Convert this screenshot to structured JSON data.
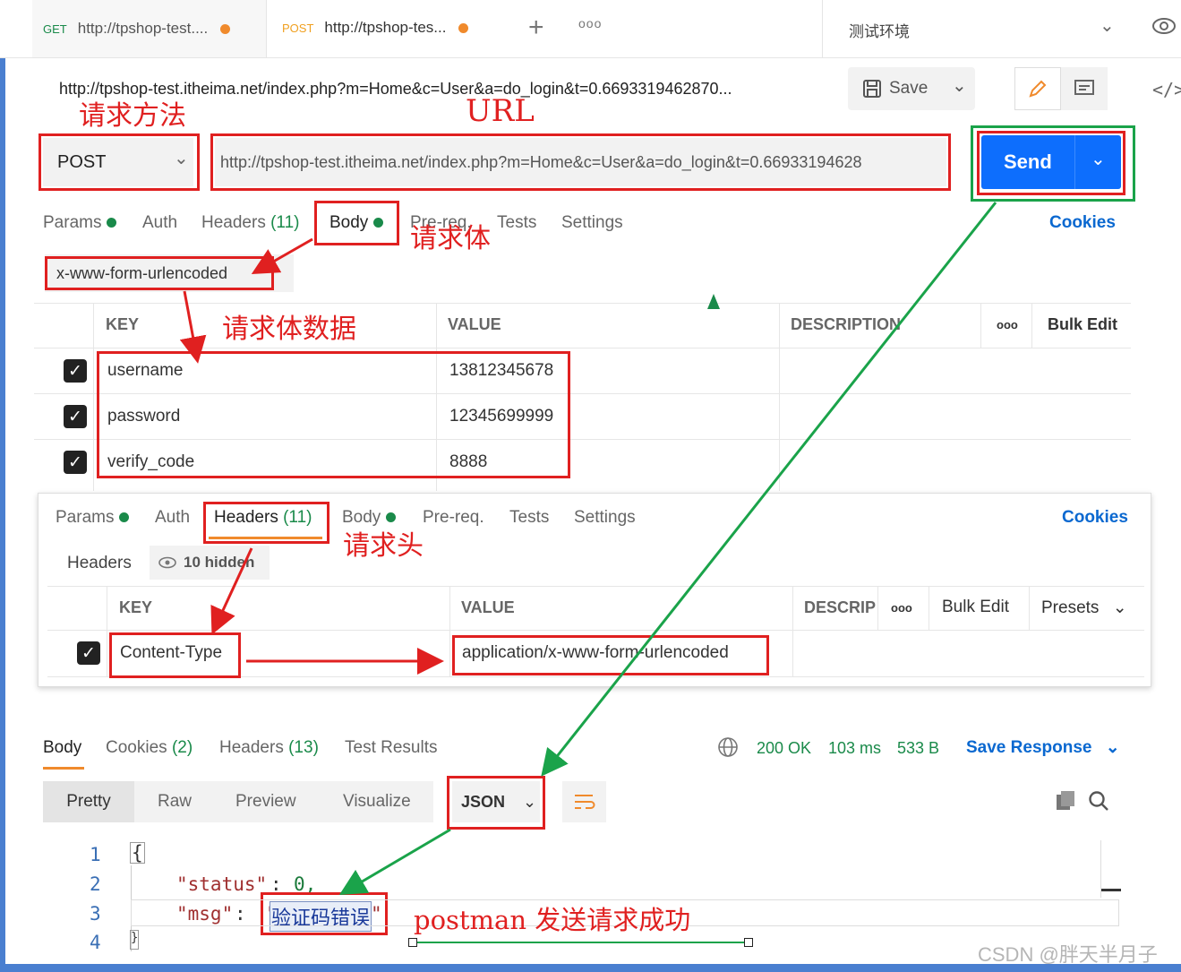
{
  "tabs": [
    {
      "method": "GET",
      "url": "http://tpshop-test...."
    },
    {
      "method": "POST",
      "url": "http://tpshop-tes..."
    }
  ],
  "environment": "测试环境",
  "request_name": "http://tpshop-test.itheima.net/index.php?m=Home&c=User&a=do_login&t=0.6693319462870...",
  "save_label": "Save",
  "method": "POST",
  "url": "http://tpshop-test.itheima.net/index.php?m=Home&c=User&a=do_login&t=0.66933194628",
  "send_label": "Send",
  "request_tabs": {
    "params": "Params",
    "auth": "Auth",
    "headers": "Headers",
    "headers_count": "(11)",
    "body": "Body",
    "prereq": "Pre-req.",
    "tests": "Tests",
    "settings": "Settings",
    "cookies": "Cookies"
  },
  "body_type": "x-www-form-urlencoded",
  "body_table": {
    "col_key": "KEY",
    "col_value": "VALUE",
    "col_description": "DESCRIPTION",
    "bulk_edit": "Bulk Edit",
    "rows": [
      {
        "key": "username",
        "value": "13812345678"
      },
      {
        "key": "password",
        "value": "12345699999"
      },
      {
        "key": "verify_code",
        "value": "8888"
      }
    ]
  },
  "headers_panel": {
    "headers_label": "Headers",
    "hidden": "10 hidden",
    "col_key": "KEY",
    "col_value": "VALUE",
    "col_description": "DESCRIP",
    "bulk_edit": "Bulk Edit",
    "presets": "Presets",
    "row": {
      "key": "Content-Type",
      "value": "application/x-www-form-urlencoded"
    }
  },
  "response": {
    "tabs": {
      "body": "Body",
      "cookies": "Cookies",
      "cookies_count": "(2)",
      "headers": "Headers",
      "headers_count": "(13)",
      "test_results": "Test Results"
    },
    "status": "200 OK",
    "time": "103 ms",
    "size": "533 B",
    "save_response": "Save Response",
    "views": [
      "Pretty",
      "Raw",
      "Preview",
      "Visualize"
    ],
    "format": "JSON",
    "lines": [
      "1",
      "2",
      "3",
      "4"
    ],
    "code": {
      "open": "{",
      "status_key": "\"status\"",
      "status_val": "0,",
      "msg_key": "\"msg\"",
      "msg_val": "验证码错误",
      "close": "}"
    }
  },
  "annotations": {
    "method": "请求方法",
    "url": "URL",
    "body": "请求体",
    "body_data": "请求体数据",
    "headers": "请求头",
    "success": "postman 发送请求成功"
  },
  "watermark": "CSDN @胖天半月子",
  "colors": {
    "accent": "#f08a2c",
    "send": "#0d6efd",
    "link": "#0a68d0",
    "annotation": "#e02020",
    "arrow_green": "#1aa34a",
    "status_ok": "#1a8a4a"
  }
}
